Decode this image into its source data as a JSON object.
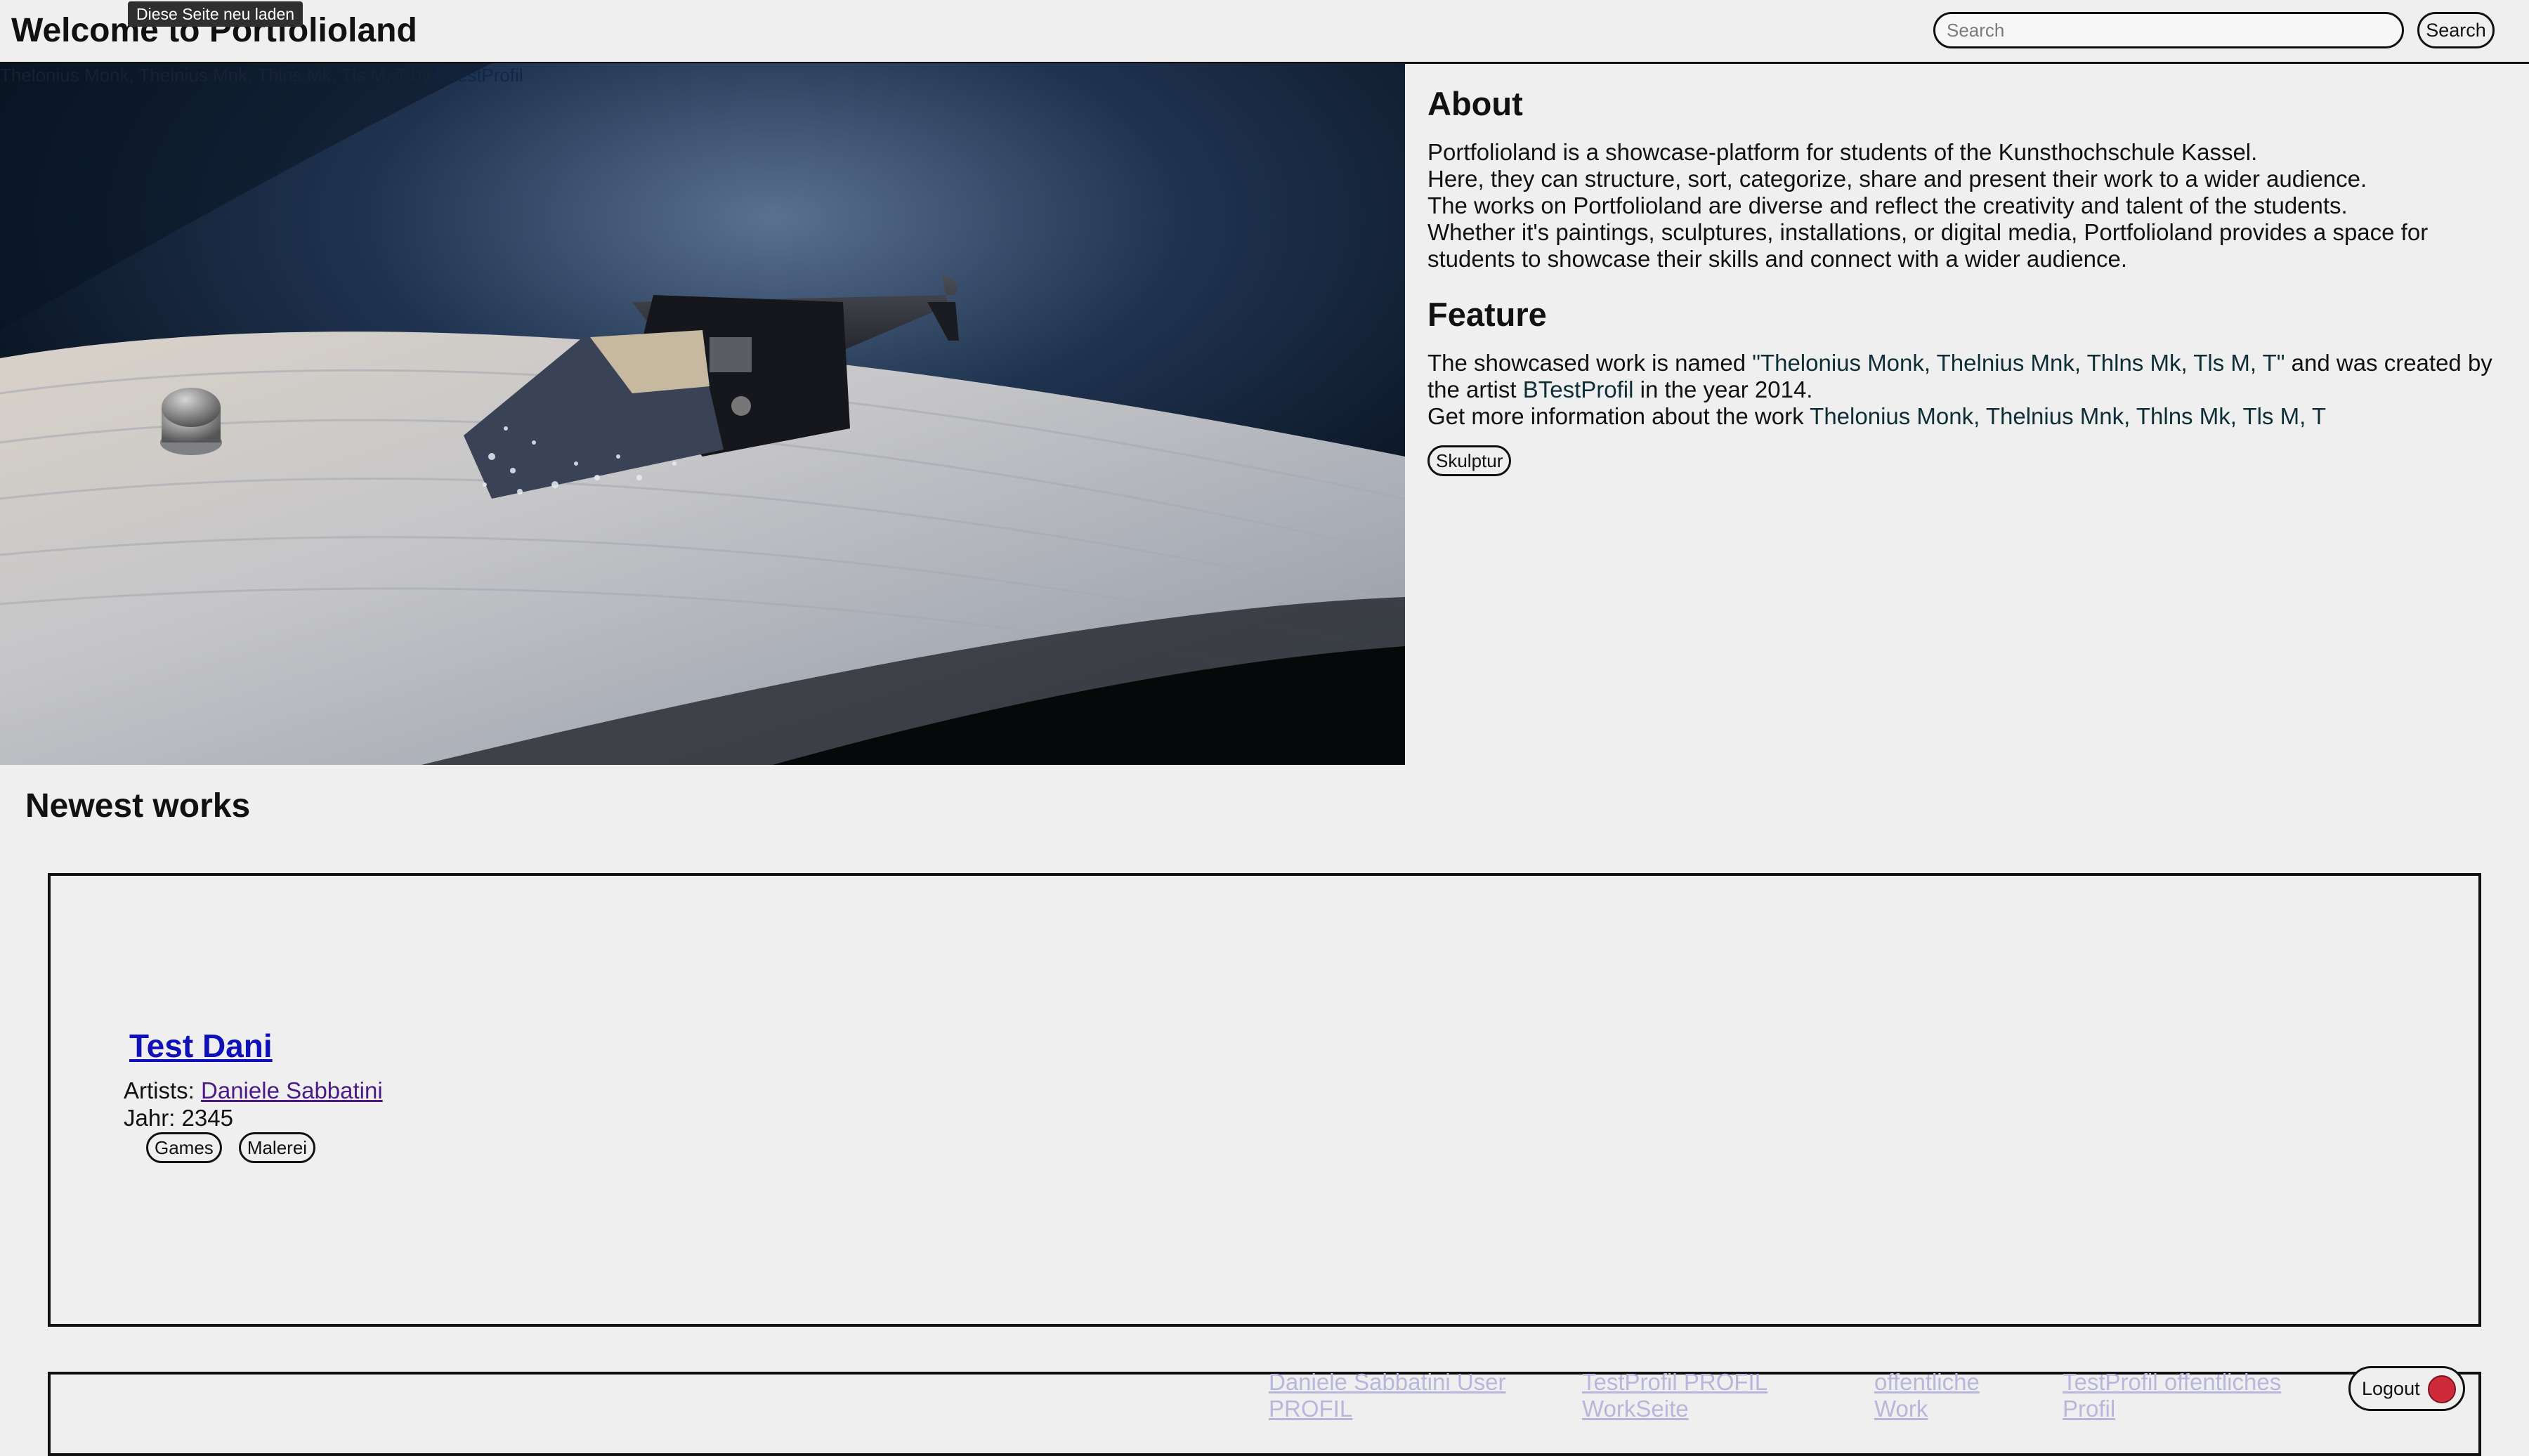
{
  "header": {
    "title": "Welcome to Portfolioland",
    "tooltip": "Diese Seite neu laden",
    "search_placeholder": "Search",
    "search_button": "Search"
  },
  "hero": {
    "image_alt": "Record player stylus on a vinyl record",
    "caption_work": "Thelonius Monk, Thelnius Mnk, Thlns Mk, Tls M, T",
    "caption_by": " by ",
    "caption_artist": "BTestProfil"
  },
  "about": {
    "heading": "About",
    "lines": [
      "Portfolioland is a showcase-platform for students of the Kunsthochschule Kassel.",
      "Here, they can structure, sort, categorize, share and present their work to a wider audience.",
      "The works on Portfolioland are diverse and reflect the creativity and talent of the students.",
      "Whether it's paintings, sculptures, installations, or digital media, Portfolioland provides a space for students to showcase their skills and connect with a wider audience."
    ]
  },
  "feature": {
    "heading": "Feature",
    "intro": "The showcased work is named ",
    "work_quoted": "\"Thelonius Monk, Thelnius Mnk, Thlns Mk, Tls M, T\"",
    "middle": " and was created by the artist ",
    "artist": "BTestProfil",
    "year_text": " in the year 2014.",
    "more_prefix": "Get more information about the work ",
    "work_link": "Thelonius Monk, Thelnius Mnk, Thlns Mk, Tls M, T",
    "tag": "Skulptur"
  },
  "newest": {
    "heading": "Newest works",
    "works": [
      {
        "title": "Test Dani",
        "artists_label": "Artists: ",
        "artist": "Daniele Sabbatini",
        "year": "Jahr: 2345",
        "tags": [
          "Games",
          "Malerei"
        ]
      }
    ]
  },
  "footer": {
    "links": [
      "Daniele Sabbatini User PROFIL",
      "TestProfil PROFIL WorkSeite",
      "offentliche Work",
      "TestProfil offentliches Profil"
    ],
    "logout": "Logout"
  },
  "colors": {
    "accent_dot": "#cf2a3a",
    "link": "#1010b8",
    "visited_link": "#4b1a86"
  }
}
